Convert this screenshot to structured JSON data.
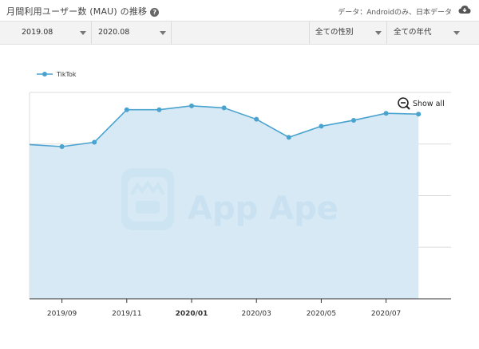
{
  "header": {
    "title": "月間利用ユーザー数 (MAU) の推移",
    "help_icon": "question-circle-icon",
    "note": "データ：Androidのみ、日本データ",
    "download_icon": "cloud-download-icon"
  },
  "filters": {
    "start": "2019.08",
    "end": "2020.08",
    "gender": "全ての性別",
    "age": "全ての年代"
  },
  "chart_controls": {
    "show_all_label": "Show all",
    "zoom_icon": "zoom-out-icon"
  },
  "watermark": {
    "text": "App Ape"
  },
  "colors": {
    "line": "#4aa3cf",
    "area": "#d6e9f5",
    "grid": "#dddddd",
    "axis": "#333333"
  },
  "chart_data": {
    "type": "area",
    "x": [
      "2019.08",
      "2019.09",
      "2019.10",
      "2019.11",
      "2019.12",
      "2020.01",
      "2020.02",
      "2020.03",
      "2020.04",
      "2020.05",
      "2020.06",
      "2020.07",
      "2020.08"
    ],
    "series": [
      {
        "name": "TikTok",
        "values": [
          59.8,
          59.0,
          60.7,
          73.3,
          73.3,
          74.8,
          74.0,
          69.6,
          62.6,
          66.9,
          69.2,
          71.9,
          71.6
        ]
      }
    ],
    "x_tick_labels": [
      {
        "label": "2019/09",
        "index": 1,
        "bold": false
      },
      {
        "label": "2019/11",
        "index": 3,
        "bold": false
      },
      {
        "label": "2020/01",
        "index": 5,
        "bold": true
      },
      {
        "label": "2020/03",
        "index": 7,
        "bold": false
      },
      {
        "label": "2020/05",
        "index": 9,
        "bold": false
      },
      {
        "label": "2020/07",
        "index": 11,
        "bold": false
      }
    ],
    "ylim": [
      0,
      80
    ],
    "y_grid": [
      20,
      40,
      60,
      80
    ],
    "grid": true,
    "legend": "top-left"
  }
}
